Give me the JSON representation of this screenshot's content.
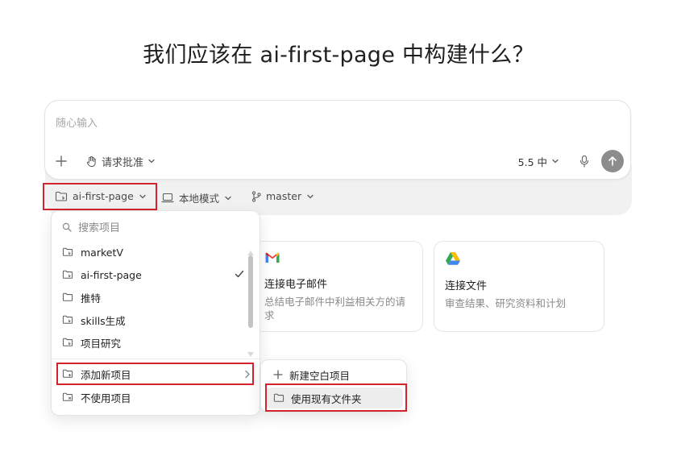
{
  "page": {
    "title": "我们应该在 ai-first-page 中构建什么？"
  },
  "composer": {
    "placeholder": "随心输入",
    "approval_label": "请求批准",
    "model_label": "5.5 中"
  },
  "context_bar": {
    "project": "ai-first-page",
    "mode": "本地模式",
    "branch": "master"
  },
  "project_menu": {
    "search_placeholder": "搜索项目",
    "items": [
      {
        "label": "marketV",
        "icon": "folder-git-icon",
        "selected": false
      },
      {
        "label": "ai-first-page",
        "icon": "folder-git-icon",
        "selected": true
      },
      {
        "label": "推特",
        "icon": "folder-icon",
        "selected": false
      },
      {
        "label": "skills生成",
        "icon": "folder-git-icon",
        "selected": false
      },
      {
        "label": "项目研究",
        "icon": "folder-git-icon",
        "selected": false
      }
    ],
    "add_project": "添加新项目",
    "no_project": "不使用项目"
  },
  "add_submenu": {
    "new_blank": "新建空白项目",
    "use_existing": "使用现有文件夹"
  },
  "cards": [
    {
      "title": "连接电子邮件",
      "description": "总结电子邮件中利益相关方的请求",
      "icon": "gmail-icon"
    },
    {
      "title": "连接文件",
      "description": "审查结果、研究资料和计划",
      "icon": "google-drive-icon"
    }
  ],
  "colors": {
    "highlight": "#d3232c",
    "send_button": "#8c8c8c",
    "gmail_red": "#EA4335",
    "gmail_blue": "#4285F4",
    "gmail_green": "#34A853",
    "gmail_yellow": "#FBBC04"
  }
}
